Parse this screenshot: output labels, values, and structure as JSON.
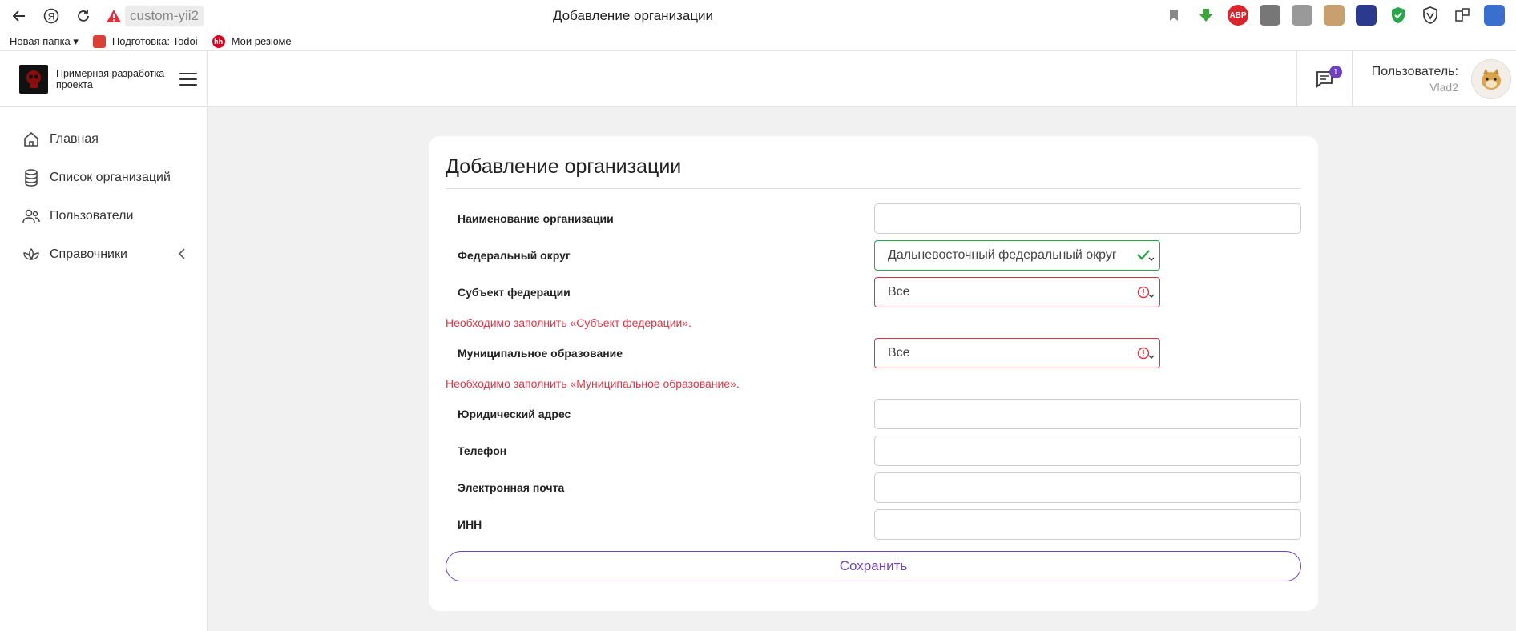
{
  "browser": {
    "url": "custom-yii2",
    "tab_title": "Добавление организации",
    "bookmarks": [
      {
        "label": "Новая папка ▾"
      },
      {
        "label": "Подготовка: Todoi"
      },
      {
        "label": "Мои резюме"
      }
    ],
    "extensions": [
      "bookmark-icon",
      "download-ext",
      "adblock-ext",
      "ext-a",
      "ext-b",
      "ext-c",
      "ext-d",
      "shield-ext",
      "vpn-ext",
      "extensions-icon",
      "ext-e"
    ],
    "adblock_label": "ABP"
  },
  "header": {
    "brand": "Примерная разработка проекта",
    "notifications_count": "1",
    "user_label": "Пользователь:",
    "user_name": "Vlad2"
  },
  "sidebar": {
    "items": [
      {
        "label": "Главная",
        "icon": "home-icon"
      },
      {
        "label": "Список организаций",
        "icon": "database-icon"
      },
      {
        "label": "Пользователи",
        "icon": "users-icon"
      },
      {
        "label": "Справочники",
        "icon": "lotus-icon"
      }
    ]
  },
  "form": {
    "title": "Добавление организации",
    "fields": {
      "name": {
        "label": "Наименование организации",
        "value": ""
      },
      "district": {
        "label": "Федеральный округ",
        "value": "Дальневосточный федеральный округ"
      },
      "subject": {
        "label": "Субъект федерации",
        "value": "Все",
        "error": "Необходимо заполнить «Субъект федерации»."
      },
      "municipality": {
        "label": "Муниципальное образование",
        "value": "Все",
        "error": "Необходимо заполнить «Муниципальное образование»."
      },
      "address": {
        "label": "Юридический адрес",
        "value": ""
      },
      "phone": {
        "label": "Телефон",
        "value": ""
      },
      "email": {
        "label": "Электронная почта",
        "value": ""
      },
      "inn": {
        "label": "ИНН",
        "value": ""
      }
    },
    "save_label": "Сохранить"
  },
  "colors": {
    "accent": "#6f42c1",
    "error": "#dc3545",
    "success": "#28a745"
  }
}
